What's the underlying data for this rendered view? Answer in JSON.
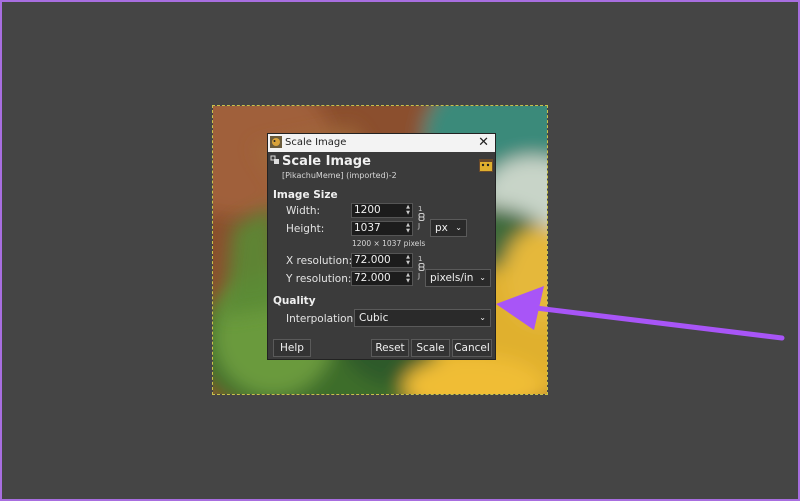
{
  "dialog": {
    "window_title": "Scale Image",
    "close_glyph": "✕",
    "header_title": "Scale Image",
    "header_subtitle": "[PikachuMeme] (imported)-2",
    "image_size": {
      "section_label": "Image Size",
      "width_label": "Width:",
      "width_value": "1200",
      "height_label": "Height:",
      "height_value": "1037",
      "unit_value": "px",
      "dimensions_note": "1200 × 1037 pixels",
      "chain_top": "1",
      "chain_bottom": "J"
    },
    "resolution": {
      "x_label": "X resolution:",
      "x_value": "72.000",
      "y_label": "Y resolution:",
      "y_value": "72.000",
      "unit_value": "pixels/in",
      "chain_top": "1",
      "chain_bottom": "J"
    },
    "quality": {
      "section_label": "Quality",
      "interpolation_label": "Interpolation:",
      "interpolation_value": "Cubic"
    },
    "buttons": {
      "help": "Help",
      "reset": "Reset",
      "scale": "Scale",
      "cancel": "Cancel"
    }
  },
  "annotation": {
    "arrow_color": "#a855f7"
  },
  "icons": [
    "gimp-icon",
    "close-icon",
    "pin-icon",
    "image-thumbnail-icon",
    "chain-icon",
    "chevron-down-icon",
    "spin-arrows-icon"
  ]
}
